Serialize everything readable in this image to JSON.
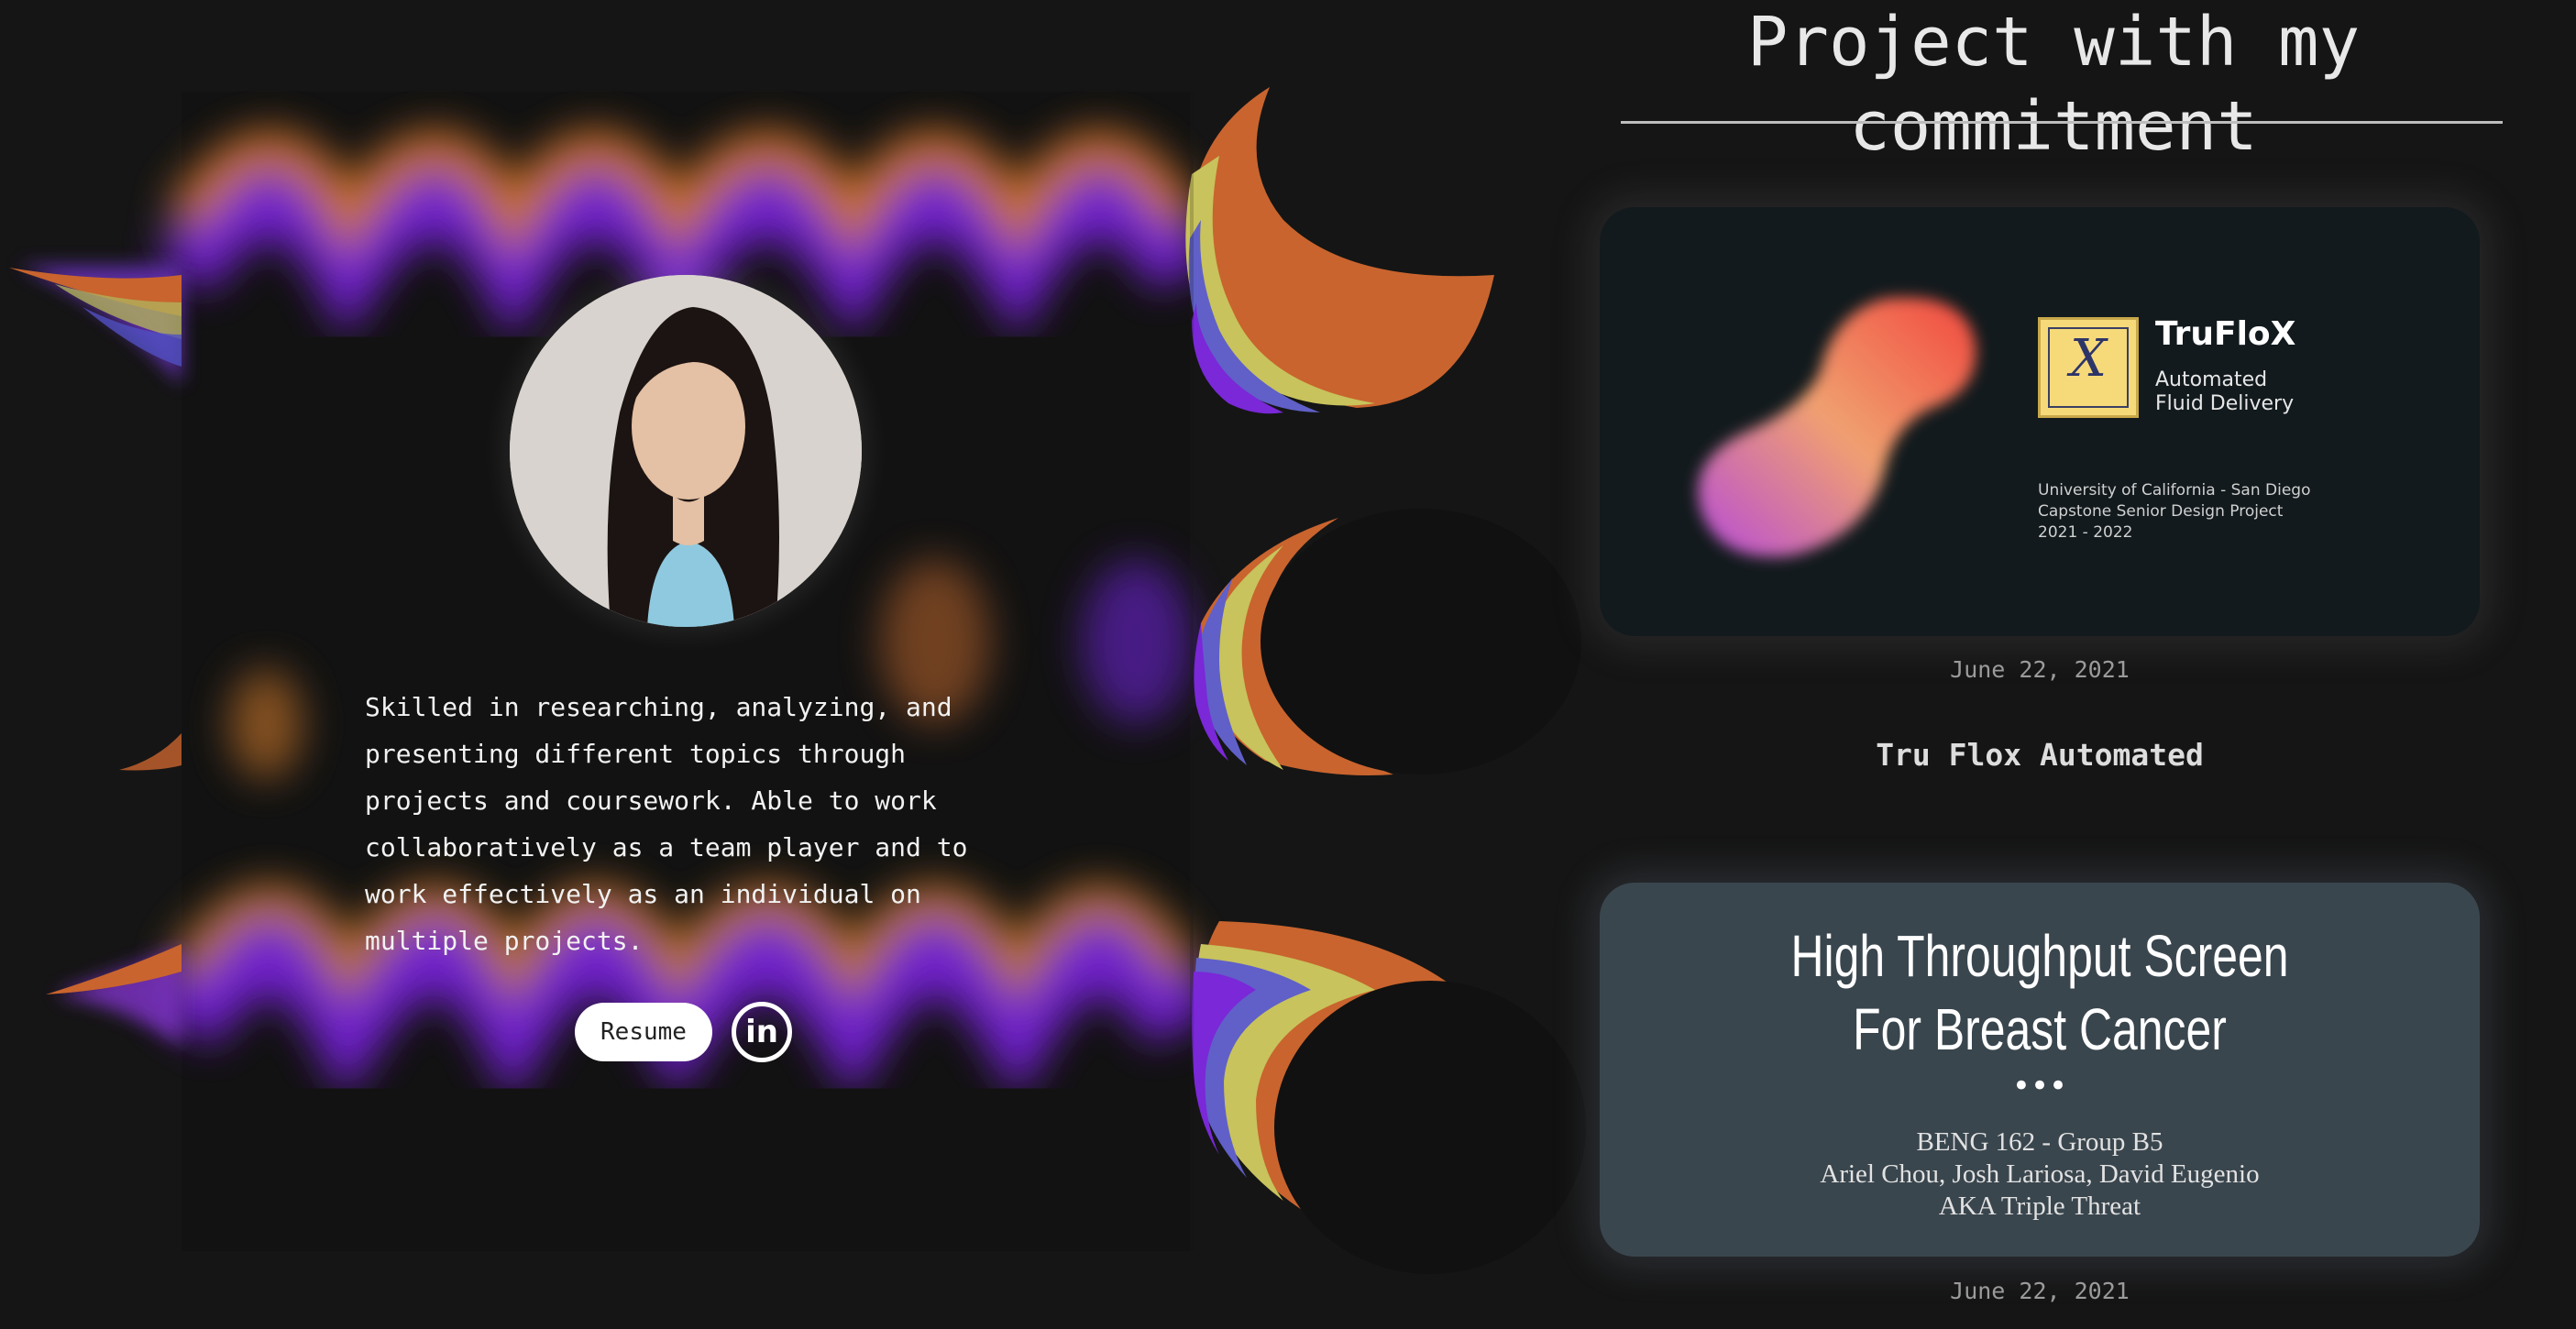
{
  "profile": {
    "bio": "Skilled in researching, analyzing, and presenting different topics through projects and coursework. Able to work collaboratively as a team player and to work effectively as an individual on multiple projects.",
    "resume_label": "Resume",
    "linkedin_glyph": "in",
    "linkedin_icon": "linkedin-icon"
  },
  "projects_section": {
    "title": "Project with my commitment",
    "projects": [
      {
        "card": {
          "brand": "TruFloX",
          "subtitle_line1": "Automated",
          "subtitle_line2": "Fluid Delivery",
          "institution_line1": "University of California - San Diego",
          "institution_line2": "Capstone Senior Design Project",
          "institution_line3": "2021 - 2022",
          "logo_mark": "X"
        },
        "date": "June 22, 2021",
        "name": "Tru Flox Automated"
      },
      {
        "card": {
          "title_line1": "High Throughput Screen",
          "title_line2": "For Breast Cancer",
          "dots": "•••",
          "course": "BENG 162 - Group B5",
          "members": "Ariel Chou, Josh Lariosa, David Eugenio",
          "nickname": "AKA Triple Threat"
        },
        "date": "June 22, 2021"
      }
    ]
  },
  "colors": {
    "background": "#151515",
    "card1_bg": "#121a1d",
    "card2_bg": "#3a464e",
    "rainbow": [
      "#8a2be2",
      "#5a3fd0",
      "#c8d060",
      "#e08a30",
      "#d0402a"
    ]
  }
}
